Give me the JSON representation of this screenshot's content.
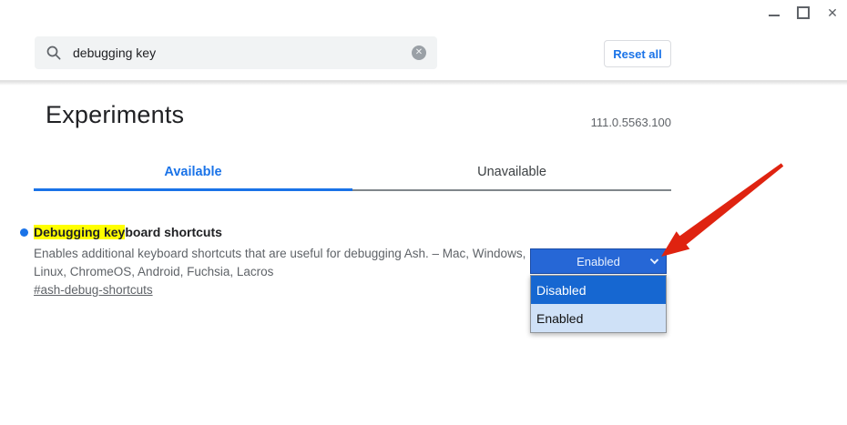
{
  "window_controls": {
    "minimize_icon": "minimize",
    "maximize_icon": "maximize",
    "close_icon": "✕"
  },
  "header": {
    "search": {
      "value": "debugging key",
      "clear_icon": "✕"
    },
    "reset_all_label": "Reset all"
  },
  "page": {
    "title": "Experiments",
    "version": "111.0.5563.100"
  },
  "tabs": [
    {
      "label": "Available",
      "active": true
    },
    {
      "label": "Unavailable",
      "active": false
    }
  ],
  "flag": {
    "title_highlight": "Debugging key",
    "title_rest": "board shortcuts",
    "description": "Enables additional keyboard shortcuts that are useful for debugging Ash. – Mac, Windows, Linux, ChromeOS, Android, Fuchsia, Lacros",
    "link": "#ash-debug-shortcuts",
    "select": {
      "value": "Enabled",
      "options": [
        "Disabled",
        "Enabled"
      ],
      "highlighted_option": "Disabled"
    }
  },
  "colors": {
    "accent_blue": "#1a73e8",
    "highlight_yellow": "#ffff00",
    "select_bg": "#2667d6",
    "select_border": "#1b4ca6",
    "select_text": "#e8f0fe",
    "option_selected_bg": "#1667d1",
    "option_selected_text": "#ffffff",
    "option_current_bg": "#cfe1f7",
    "option_current_text": "#111111",
    "arrow_red": "#df2310"
  }
}
